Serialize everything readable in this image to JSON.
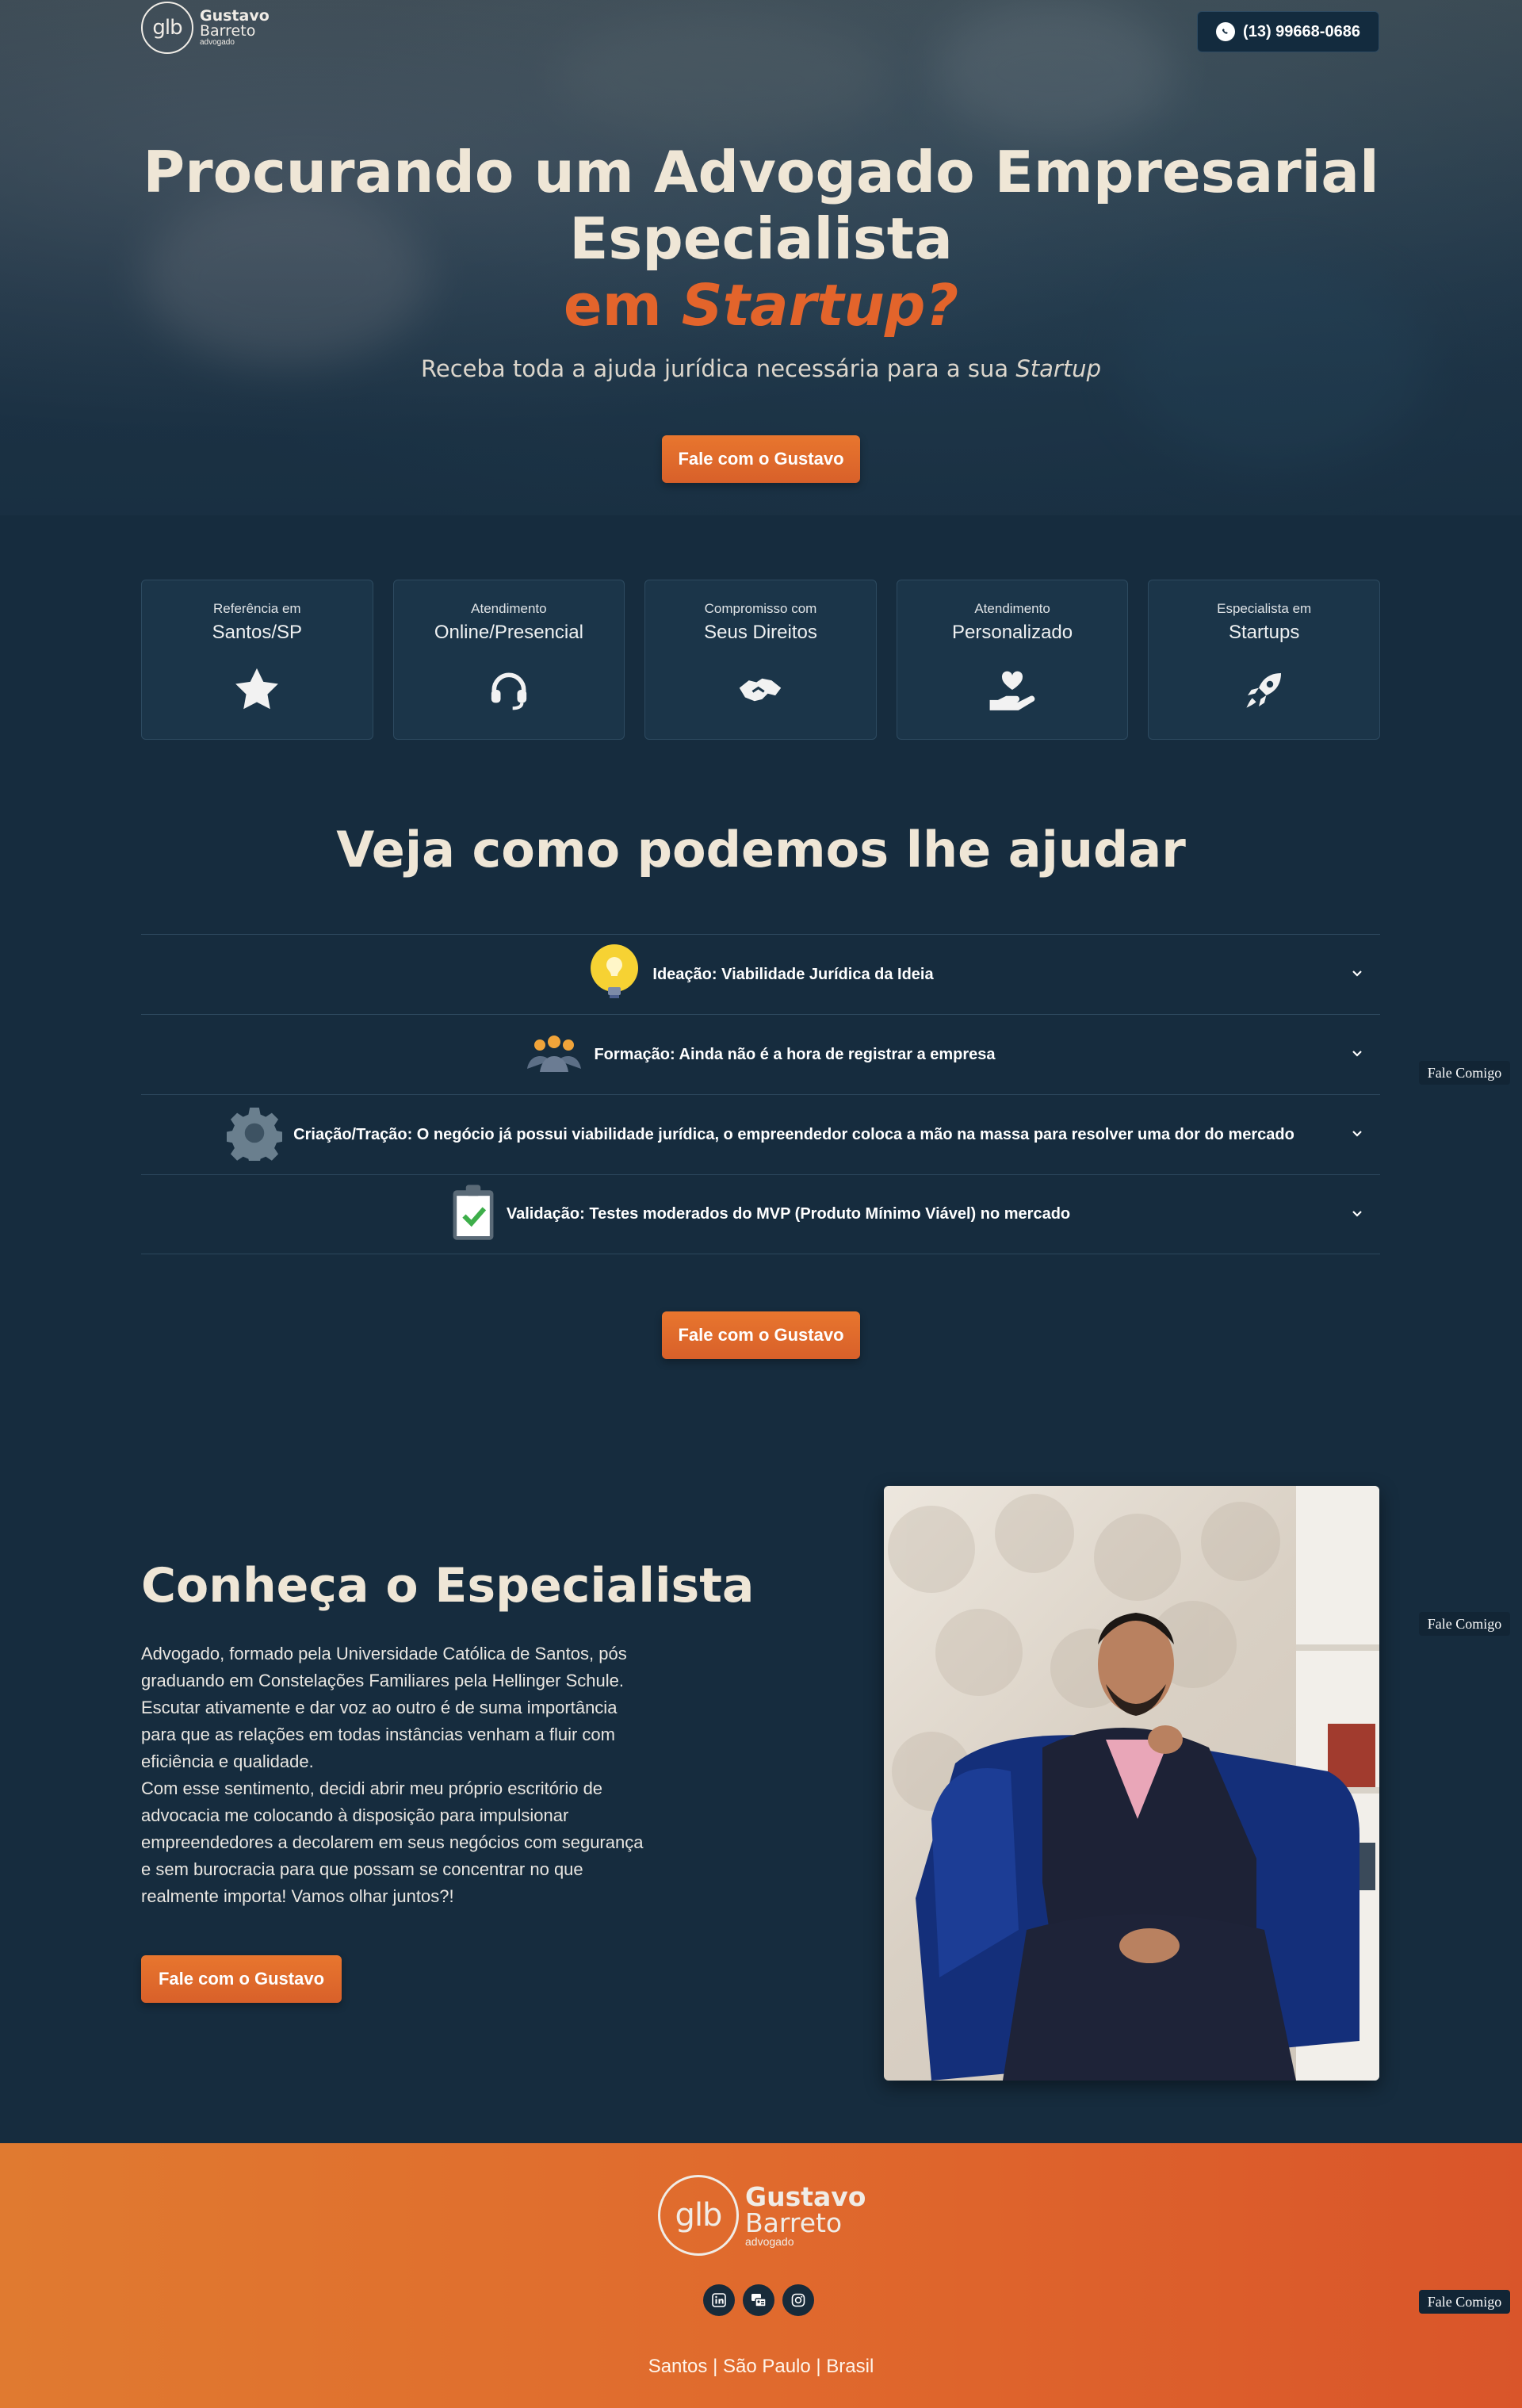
{
  "header": {
    "logo": {
      "initials": "glb",
      "name_first": "Gustavo",
      "name_last": "Barreto",
      "role": "advogado"
    },
    "phone_label": "(13) 99668-0686"
  },
  "hero": {
    "title_line1": "Procurando um Advogado Empresarial",
    "title_line2": "Especialista",
    "title_line3_prefix": "em ",
    "title_line3_accent": "Startup?",
    "subtitle_prefix": "Receba toda a ajuda jurídica necessária para a sua ",
    "subtitle_accent": "Startup",
    "cta": "Fale com o Gustavo"
  },
  "features": [
    {
      "small": "Referência em",
      "big": "Santos/SP",
      "icon": "star-icon"
    },
    {
      "small": "Atendimento",
      "big": "Online/Presencial",
      "icon": "headset-icon"
    },
    {
      "small": "Compromisso com",
      "big": "Seus Direitos",
      "icon": "handshake-icon"
    },
    {
      "small": "Atendimento",
      "big": "Personalizado",
      "icon": "hand-heart-icon"
    },
    {
      "small": "Especialista em",
      "big": "Startups",
      "icon": "rocket-icon"
    }
  ],
  "help": {
    "title": "Veja como podemos lhe ajudar",
    "items": [
      {
        "label": "Ideação: Viabilidade Jurídica da Ideia",
        "icon": "lightbulb-icon"
      },
      {
        "label": "Formação: Ainda não é a hora de registrar a empresa",
        "icon": "team-icon"
      },
      {
        "label": "Criação/Tração: O negócio já possui viabilidade jurídica, o empreendedor coloca a mão na massa para resolver uma dor do mercado",
        "icon": "gear-icon"
      },
      {
        "label": "Validação: Testes moderados do MVP (Produto Mínimo Viável) no mercado",
        "icon": "clipboard-check-icon"
      }
    ],
    "cta": "Fale com o Gustavo"
  },
  "floating_tag": "Fale Comigo",
  "about": {
    "title": "Conheça o Especialista",
    "paragraph1": "Advogado, formado pela Universidade Católica de Santos, pós graduando em Constelações Familiares pela Hellinger Schule. Escutar ativamente e dar voz ao outro é de suma importância para que as relações em todas instâncias venham a fluir com eficiência e qualidade.",
    "paragraph2": "Com esse sentimento, decidi abrir meu próprio escritório de advocacia me colocando à disposição para impulsionar empreendedores a decolarem em seus negócios com segurança e sem burocracia para que possam se concentrar no que realmente importa! Vamos olhar juntos?!",
    "cta": "Fale com o Gustavo"
  },
  "footer": {
    "logo": {
      "initials": "glb",
      "name_first": "Gustavo",
      "name_last": "Barreto",
      "role": "advogado"
    },
    "socials": [
      "linkedin-icon",
      "contact-card-icon",
      "instagram-icon"
    ],
    "location": "Santos | São Paulo | Brasil"
  },
  "colors": {
    "accent": "#e3642b",
    "background": "#162c3e",
    "cta": "#e06a2d"
  }
}
